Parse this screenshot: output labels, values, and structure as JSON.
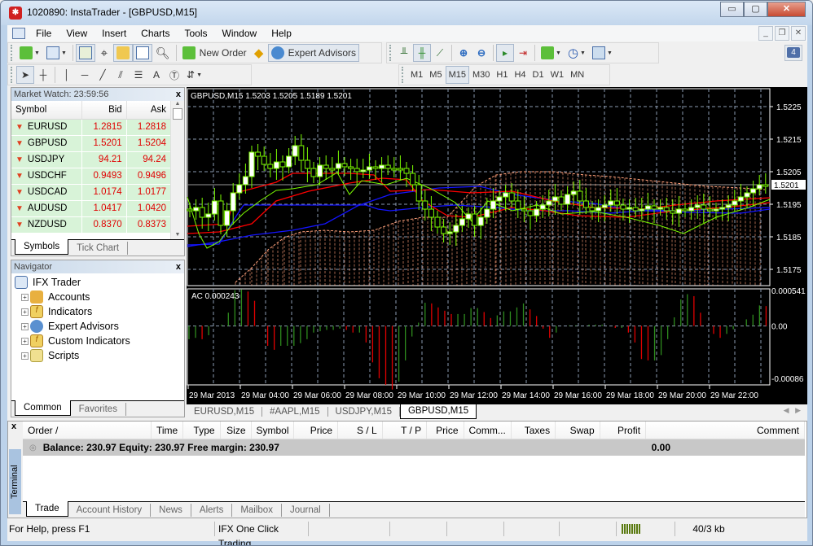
{
  "window": {
    "title": "1020890: InstaTrader - [GBPUSD,M15]",
    "icon": "instatrader-logo-icon"
  },
  "menu": [
    "File",
    "View",
    "Insert",
    "Charts",
    "Tools",
    "Window",
    "Help"
  ],
  "toolbar": {
    "new_order_label": "New Order",
    "expert_advisors_label": "Expert Advisors"
  },
  "timeframes": [
    "M1",
    "M5",
    "M15",
    "M30",
    "H1",
    "H4",
    "D1",
    "W1",
    "MN"
  ],
  "active_timeframe": "M15",
  "notifications": {
    "count": "4"
  },
  "market_watch": {
    "title": "Market Watch: 23:59:56",
    "columns": [
      "Symbol",
      "Bid",
      "Ask"
    ],
    "rows": [
      {
        "symbol": "EURUSD",
        "bid": "1.2815",
        "ask": "1.2818"
      },
      {
        "symbol": "GBPUSD",
        "bid": "1.5201",
        "ask": "1.5204"
      },
      {
        "symbol": "USDJPY",
        "bid": "94.21",
        "ask": "94.24"
      },
      {
        "symbol": "USDCHF",
        "bid": "0.9493",
        "ask": "0.9496"
      },
      {
        "symbol": "USDCAD",
        "bid": "1.0174",
        "ask": "1.0177"
      },
      {
        "symbol": "AUDUSD",
        "bid": "1.0417",
        "ask": "1.0420"
      },
      {
        "symbol": "NZDUSD",
        "bid": "0.8370",
        "ask": "0.8373"
      }
    ],
    "tabs": [
      "Symbols",
      "Tick Chart"
    ]
  },
  "navigator": {
    "title": "Navigator",
    "root": "IFX Trader",
    "items": [
      "Accounts",
      "Indicators",
      "Expert Advisors",
      "Custom Indicators",
      "Scripts"
    ],
    "tabs": [
      "Common",
      "Favorites"
    ]
  },
  "chart": {
    "header": "GBPUSD,M15  1.5203 1.5205 1.5189 1.5201",
    "price_labels": [
      "1.5225",
      "1.5215",
      "1.5205",
      "1.5195",
      "1.5185",
      "1.5175"
    ],
    "current_price": "1.5201",
    "indicator_label": "AC 0.000243",
    "indicator_labels": [
      "0.000541",
      "0.00",
      "-0.00086"
    ],
    "time_labels": [
      "29 Mar 2013",
      "29 Mar 04:00",
      "29 Mar 06:00",
      "29 Mar 08:00",
      "29 Mar 10:00",
      "29 Mar 12:00",
      "29 Mar 14:00",
      "29 Mar 16:00",
      "29 Mar 18:00",
      "29 Mar 20:00",
      "29 Mar 22:00"
    ],
    "tabs": [
      "EURUSD,M15",
      "#AAPL,M15",
      "USDJPY,M15",
      "GBPUSD,M15"
    ],
    "active_tab": "GBPUSD,M15",
    "colors": {
      "bull": "#7cfc00",
      "ma_red": "#ff0000",
      "ma_blue": "#0000ff",
      "cloud": "#ffa07a",
      "ac_up": "#2e8b1e",
      "ac_down": "#e00000"
    }
  },
  "terminal": {
    "label": "Terminal",
    "columns": [
      "Order",
      "Time",
      "Type",
      "Size",
      "Symbol",
      "Price",
      "S / L",
      "T / P",
      "Price",
      "Comm...",
      "Taxes",
      "Swap",
      "Profit",
      "Comment"
    ],
    "balance_text": "Balance: 230.97  Equity: 230.97  Free margin: 230.97",
    "profit": "0.00",
    "tabs": [
      "Trade",
      "Account History",
      "News",
      "Alerts",
      "Mailbox",
      "Journal"
    ]
  },
  "status": {
    "help": "For Help, press F1",
    "one_click": "IFX One Click Trading",
    "traffic": "40/3 kb"
  }
}
